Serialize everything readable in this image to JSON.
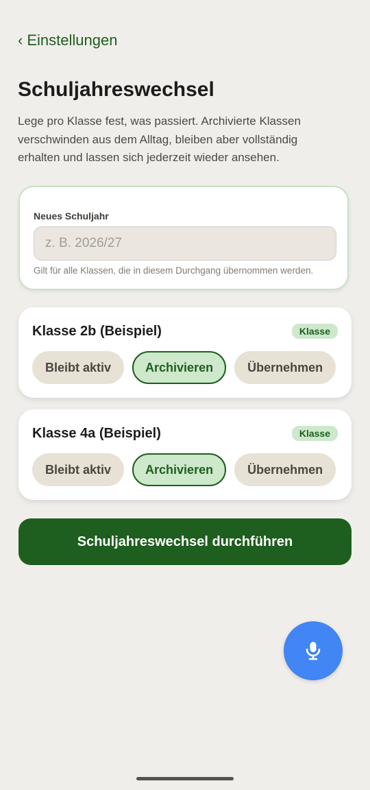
{
  "nav": {
    "back_label": "Einstellungen"
  },
  "header": {
    "title": "Schuljahreswechsel",
    "description": "Lege pro Klasse fest, was passiert. Archivierte Klassen verschwinden aus dem Alltag, bleiben aber vollständig erhalten und lassen sich jederzeit wieder ansehen."
  },
  "school_year": {
    "label": "Neues Schuljahr",
    "value": "",
    "placeholder": "z. B. 2026/27",
    "hint": "Gilt für alle Klassen, die in diesem Durchgang übernommen werden."
  },
  "classes": [
    {
      "name": "Klasse 2b (Beispiel)",
      "badge": "Klasse",
      "options": [
        "Bleibt aktiv",
        "Archivieren",
        "Übernehmen"
      ],
      "selected": "Archivieren"
    },
    {
      "name": "Klasse 4a (Beispiel)",
      "badge": "Klasse",
      "options": [
        "Bleibt aktiv",
        "Archivieren",
        "Übernehmen"
      ],
      "selected": "Archivieren"
    }
  ],
  "actions": {
    "submit_label": "Schuljahreswechsel durchführen"
  },
  "fab": {
    "icon": "microphone-icon"
  },
  "colors": {
    "accent": "#1e5e1e",
    "accent_light": "#cde8cb",
    "fab": "#4285f4",
    "background": "#f0eeeb"
  }
}
